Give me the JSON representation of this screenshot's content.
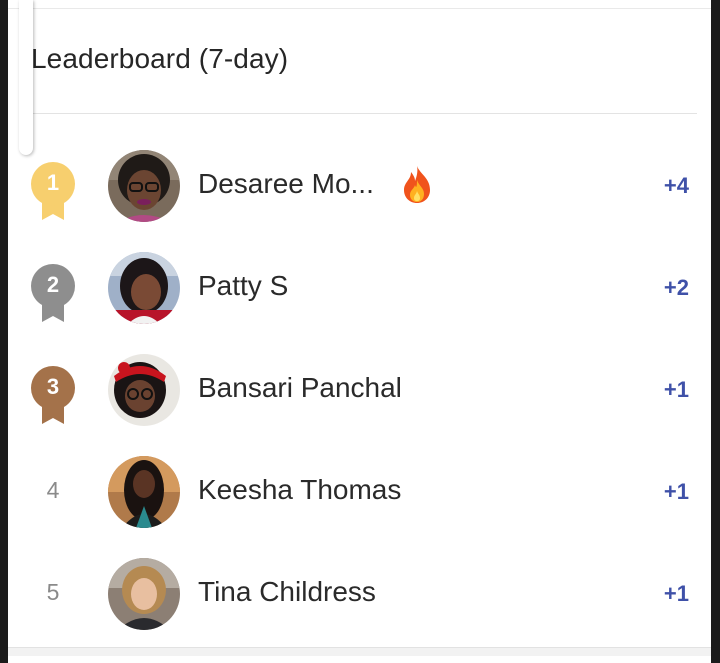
{
  "leaderboard": {
    "title": "Leaderboard (7-day)",
    "colors": {
      "gold": "#f7cf6e",
      "silver": "#8e8e8e",
      "bronze": "#a4724a",
      "score": "#3f51a8"
    },
    "entries": [
      {
        "rank": "1",
        "name": "Desaree Mo...",
        "score": "+4",
        "badge": "fire-icon"
      },
      {
        "rank": "2",
        "name": "Patty S",
        "score": "+2"
      },
      {
        "rank": "3",
        "name": "Bansari Panchal",
        "score": "+1"
      },
      {
        "rank": "4",
        "name": "Keesha Thomas",
        "score": "+1"
      },
      {
        "rank": "5",
        "name": "Tina Childress",
        "score": "+1"
      }
    ]
  }
}
